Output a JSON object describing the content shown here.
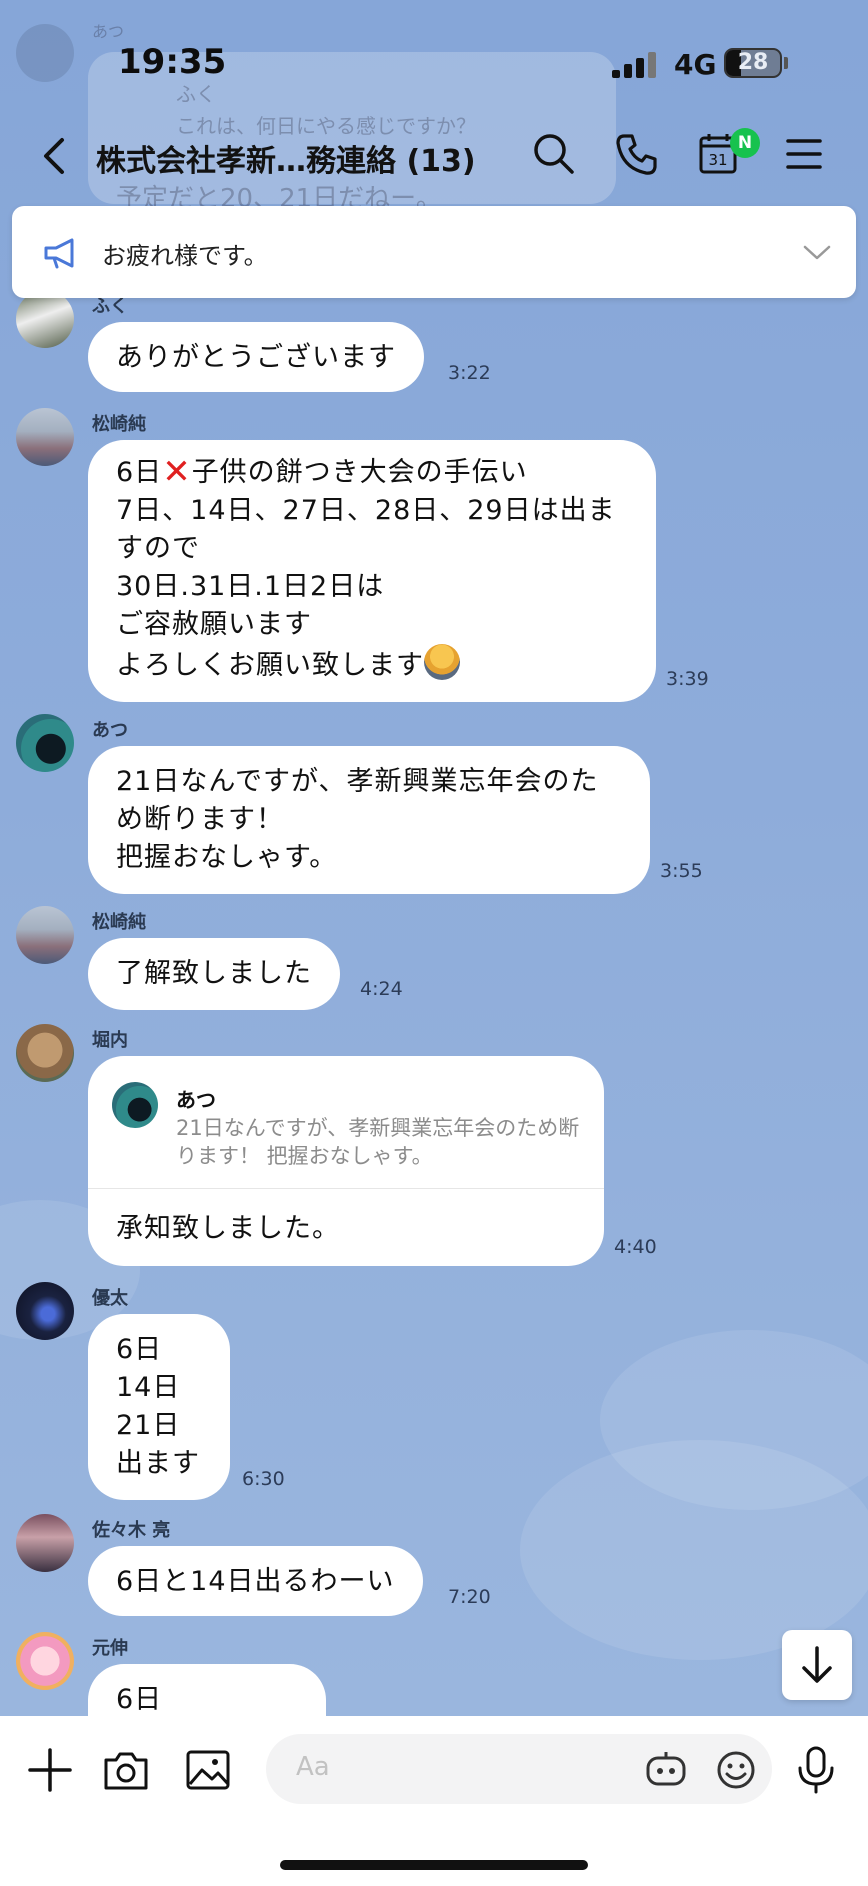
{
  "status_bar": {
    "time": "19:35",
    "network": "4G",
    "battery": "28",
    "battery_level": 0.28
  },
  "header": {
    "title": "株式会社孝新…務連絡 (13)",
    "calendar_day": "31",
    "calendar_badge": "N"
  },
  "ghost": {
    "sender": "あつ",
    "name": "ふく",
    "line1": "これは、何日にやる感じですか？",
    "line2": "予定だと20、21日だねー。"
  },
  "announcement": {
    "text": "お疲れ様です。"
  },
  "messages": [
    {
      "sender": "ふく",
      "text": "ありがとうございます",
      "time": "3:22"
    },
    {
      "sender": "松崎純",
      "line1_pre": "6日",
      "line1_post": "子供の餅つき大会の手伝い",
      "text_rest": "7日、14日、27日、28日、29日は出ま\nすので\n30日.31日.1日2日は\nご容赦願います\nよろしくお願い致します",
      "time": "3:39"
    },
    {
      "sender": "あつ",
      "text": "21日なんですが、孝新興業忘年会のた\nめ断ります！\n把握おなしゃす。",
      "time": "3:55"
    },
    {
      "sender": "松崎純",
      "text": "了解致しました",
      "time": "4:24"
    },
    {
      "sender": "堀内",
      "reply_name": "あつ",
      "reply_quote": "21日なんですが、孝新興業忘年会のため断ります！ 把握おなしゃす。",
      "text": "承知致しました。",
      "time": "4:40"
    },
    {
      "sender": "優太",
      "text": "6日\n14日\n21日\n出ます",
      "time": "6:30"
    },
    {
      "sender": "佐々木 亮",
      "text": "6日と14日出るわーい",
      "time": "7:20"
    },
    {
      "sender": "元伸",
      "text": "6日"
    }
  ],
  "input": {
    "placeholder": "Aa"
  },
  "icons": [
    "back-icon",
    "search-icon",
    "phone-icon",
    "calendar-icon",
    "menu-icon",
    "megaphone-icon",
    "chevron-down-icon",
    "scroll-down-icon",
    "plus-icon",
    "camera-icon",
    "image-icon",
    "bot-icon",
    "emoji-icon",
    "mic-icon"
  ]
}
